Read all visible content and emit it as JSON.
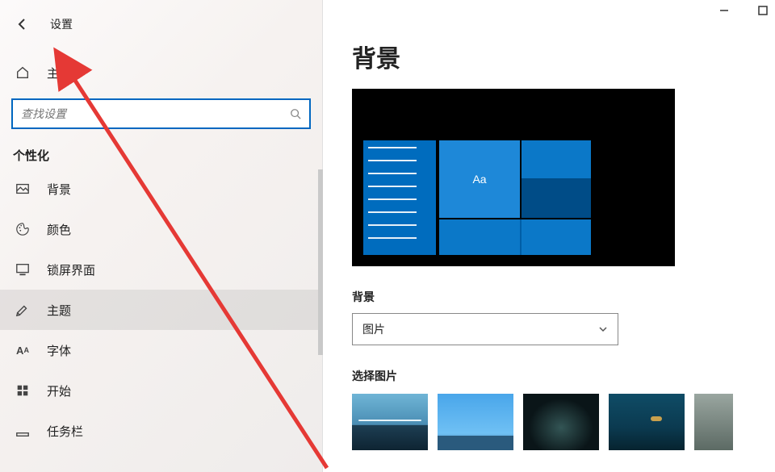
{
  "window": {
    "title": "设置",
    "minimize": "−",
    "maximize": "□"
  },
  "sidebar": {
    "home_label": "主页",
    "search_placeholder": "查找设置",
    "section": "个性化",
    "items": [
      {
        "label": "背景",
        "icon": "image-icon"
      },
      {
        "label": "颜色",
        "icon": "palette-icon"
      },
      {
        "label": "锁屏界面",
        "icon": "lockscreen-icon"
      },
      {
        "label": "主题",
        "icon": "theme-icon"
      },
      {
        "label": "字体",
        "icon": "font-icon"
      },
      {
        "label": "开始",
        "icon": "start-icon"
      },
      {
        "label": "任务栏",
        "icon": "taskbar-icon"
      }
    ]
  },
  "content": {
    "page_title": "背景",
    "preview_tile_text": "Aa",
    "bg_label": "背景",
    "bg_dropdown_value": "图片",
    "choose_label": "选择图片"
  }
}
